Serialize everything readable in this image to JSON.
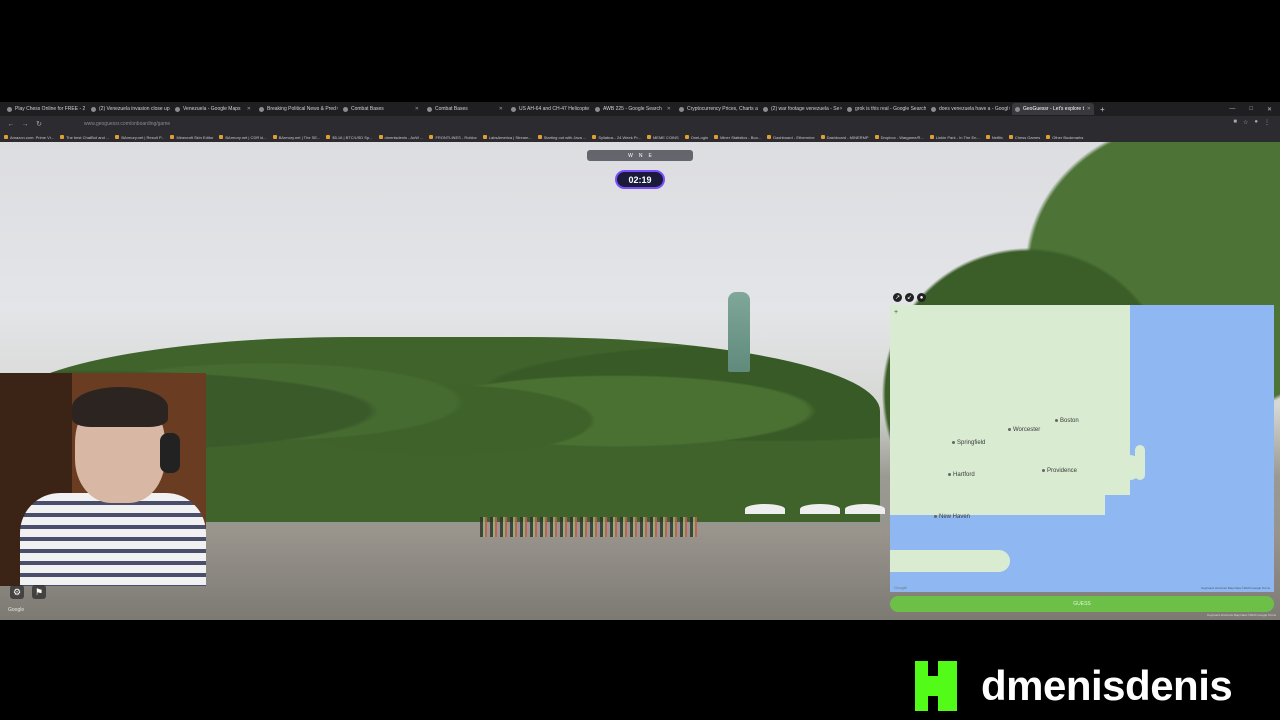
{
  "tabs": [
    {
      "label": "Play Chess Online for FREE - 2 P"
    },
    {
      "label": "(2) Venezuela invasion close up"
    },
    {
      "label": "Venezuela - Google Maps"
    },
    {
      "label": "Breaking Political News & Pred"
    },
    {
      "label": "Combat Bases"
    },
    {
      "label": "Combat Bases"
    },
    {
      "label": "US AH-64 and CH-47 Helicopte"
    },
    {
      "label": "AWB 225 - Google Search"
    },
    {
      "label": "Cryptocurrency Prices, Charts a"
    },
    {
      "label": "(2) war footage venezuela - Se"
    },
    {
      "label": "grok is this real - Google Search"
    },
    {
      "label": "does venezuela have a - Googl"
    },
    {
      "label": "GeoGuessr - Let's explore t",
      "active": true
    }
  ],
  "address": {
    "url": "www.geoguessr.com/onboarding/game"
  },
  "bookmarks": [
    "Amazon.com: Prime Vi...",
    "The best ChatBot and ...",
    "BArmory.net | Result P...",
    "Minecraft Skin Editor",
    "BArmory.net | CDR ki...",
    "BArmory.net | The SE...",
    "$5.16 | BTC/USD Sp...",
    "dmenisdenis - AoW ...",
    "FRONTLINES - Roblox",
    "LabsAmerica | Stream...",
    "Starting out with Java ...",
    "Syllabus - 24 Week Pr...",
    "MEME COINS",
    "OneLogin",
    "Miner Statistics - Boo...",
    "Dashboard - Ethermine",
    "Dashboard - MINERMP",
    "Dropbox - Wargame/R...",
    "Linkin Park - In The En...",
    "Netflix",
    "Chess Games",
    "Other Bookmarks"
  ],
  "game": {
    "timer": "02:19",
    "compass": [
      "W",
      "N",
      "E"
    ]
  },
  "map": {
    "cities": [
      {
        "name": "Boston"
      },
      {
        "name": "Springfield"
      },
      {
        "name": "Worcester"
      },
      {
        "name": "Providence"
      },
      {
        "name": "Hartford"
      },
      {
        "name": "New Haven"
      }
    ],
    "attribution": "Keyboard shortcuts   Map Data ©2024 Google   Terms",
    "logo": "Google",
    "guess_label": "GUESS"
  },
  "branding": {
    "name": "dmenisdenis",
    "color": "#53fc18"
  },
  "colors": {
    "timer_border": "#7b4dff",
    "guess_button": "#6cc048",
    "water": "#8fb7f2",
    "land": "#d9ecd2"
  }
}
